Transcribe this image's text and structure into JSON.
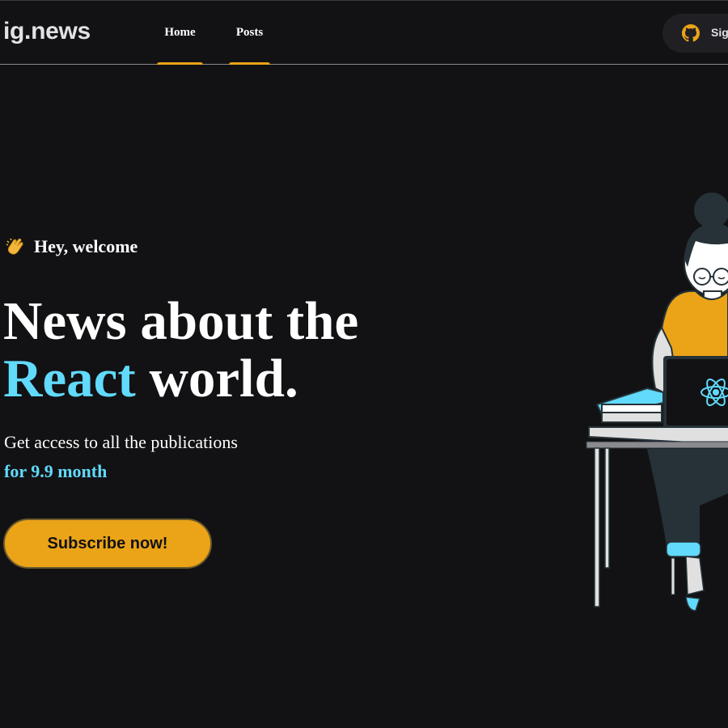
{
  "header": {
    "logo": "ig.news",
    "nav": [
      {
        "label": "Home",
        "active": true
      },
      {
        "label": "Posts",
        "active": true
      }
    ],
    "signin": {
      "label": "Sig",
      "icon": "github-icon"
    }
  },
  "hero": {
    "welcome_emoji": "clapping-hands-icon",
    "welcome_text": "Hey, welcome",
    "headline_line1": "News about the",
    "headline_accent": "React",
    "headline_rest": "world.",
    "subtitle": "Get access to all the publications",
    "price": "for 9.9 month",
    "cta_label": "Subscribe now!"
  },
  "illustration": {
    "name": "woman-coding-at-laptop-illustration",
    "logo": "react-logo-icon"
  },
  "colors": {
    "background": "#121214",
    "accent_cyan": "#61dafb",
    "accent_yellow": "#eba417",
    "header_border": "#8a8a8f"
  }
}
